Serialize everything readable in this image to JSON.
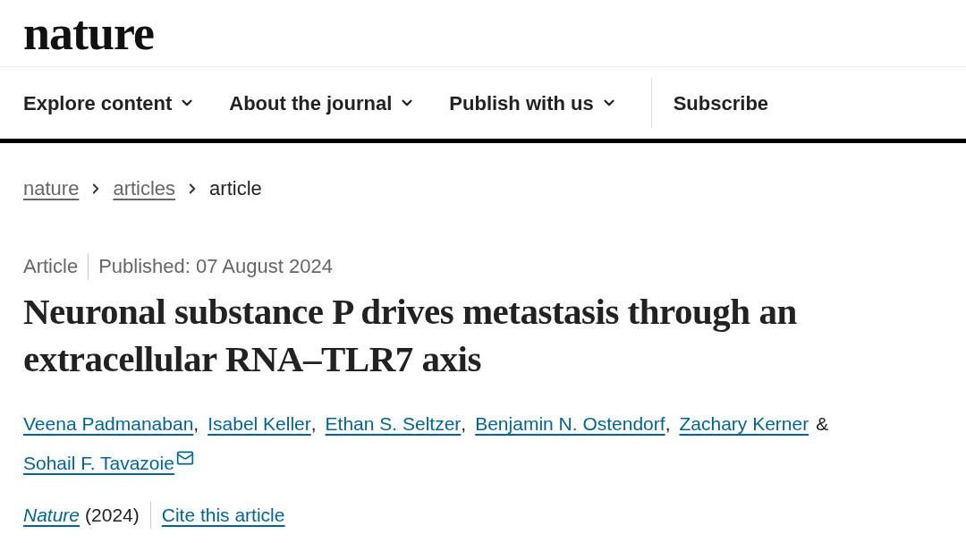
{
  "logo": "nature",
  "nav": [
    {
      "label": "Explore content",
      "has_menu": true
    },
    {
      "label": "About the journal",
      "has_menu": true
    },
    {
      "label": "Publish with us",
      "has_menu": true
    },
    {
      "label": "Subscribe",
      "has_menu": false
    }
  ],
  "breadcrumb": [
    {
      "label": "nature",
      "current": false
    },
    {
      "label": "articles",
      "current": false
    },
    {
      "label": "article",
      "current": true
    }
  ],
  "meta": {
    "type": "Article",
    "published": "Published: 07 August 2024"
  },
  "title": "Neuronal substance P drives metastasis through an extracellular RNA–TLR7 axis",
  "authors": [
    {
      "name": "Veena Padmanaban",
      "separator": ",",
      "corresponding": false
    },
    {
      "name": "Isabel Keller",
      "separator": ",",
      "corresponding": false
    },
    {
      "name": "Ethan S. Seltzer",
      "separator": ",",
      "corresponding": false
    },
    {
      "name": "Benjamin N. Ostendorf",
      "separator": ",",
      "corresponding": false
    },
    {
      "name": "Zachary Kerner",
      "separator": "&",
      "corresponding": false
    },
    {
      "name": "Sohail F. Tavazoie",
      "corresponding": true
    }
  ],
  "citation": {
    "journal": "Nature",
    "year": "(2024)",
    "cite": "Cite this article"
  }
}
